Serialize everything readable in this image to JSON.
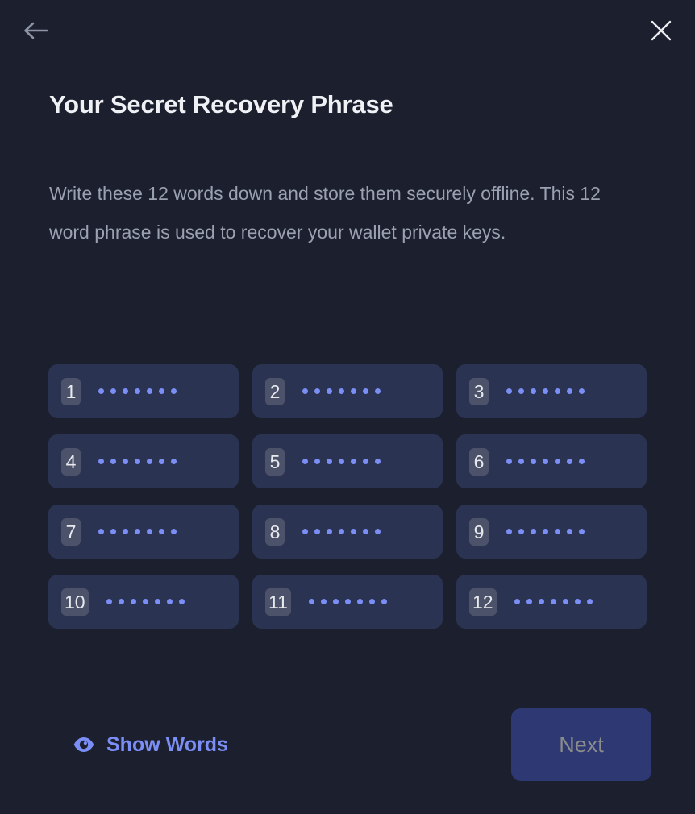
{
  "theme": {
    "background": "#1b1f2e",
    "chip_background": "#2b3352",
    "badge_background": "#4c5269",
    "accent": "#7b8ef5",
    "title_color": "#f0f1f4",
    "body_color": "#9aa1b0",
    "primary_button_background": "#2e3873",
    "primary_button_text": "#8b8c8c"
  },
  "topbar": {
    "back_icon": "arrow-left-icon",
    "close_icon": "close-icon"
  },
  "header": {
    "title": "Your Secret Recovery Phrase",
    "description": "Write these 12 words down and store them securely offline. This 12 word phrase is used to recover your wallet private keys."
  },
  "phrase": {
    "masked": true,
    "dots_per_word": 7,
    "words": [
      {
        "index": "1",
        "value": ""
      },
      {
        "index": "2",
        "value": ""
      },
      {
        "index": "3",
        "value": ""
      },
      {
        "index": "4",
        "value": ""
      },
      {
        "index": "5",
        "value": ""
      },
      {
        "index": "6",
        "value": ""
      },
      {
        "index": "7",
        "value": ""
      },
      {
        "index": "8",
        "value": ""
      },
      {
        "index": "9",
        "value": ""
      },
      {
        "index": "10",
        "value": ""
      },
      {
        "index": "11",
        "value": ""
      },
      {
        "index": "12",
        "value": ""
      }
    ]
  },
  "footer": {
    "show_words_label": "Show Words",
    "show_words_icon": "eye-icon",
    "next_label": "Next",
    "next_disabled": true
  }
}
